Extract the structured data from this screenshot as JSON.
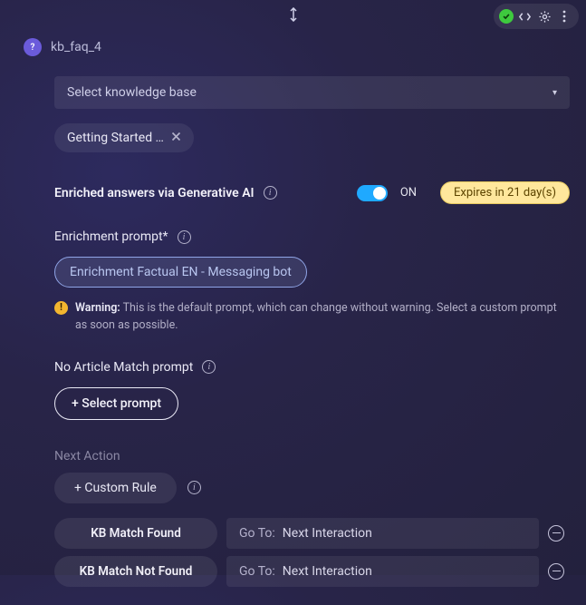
{
  "header": {
    "title": "kb_faq_4",
    "badge": "?"
  },
  "knowledge_base": {
    "placeholder": "Select knowledge base",
    "chip_label": "Getting Started …"
  },
  "enriched": {
    "label": "Enriched answers via Generative AI",
    "toggle_state": "ON",
    "expiry": "Expires in 21 day(s)"
  },
  "enrichment_prompt": {
    "label": "Enrichment prompt*",
    "selected": "Enrichment Factual EN - Messaging bot",
    "warning_label": "Warning:",
    "warning_text": "This is the default prompt, which can change without warning. Select a custom prompt as soon as possible."
  },
  "no_article": {
    "label": "No Article Match prompt",
    "button": "+ Select prompt"
  },
  "next_action": {
    "heading": "Next Action",
    "custom_rule_btn": "+ Custom Rule",
    "rules": [
      {
        "label": "KB Match Found",
        "goto_label": "Go To:",
        "goto_target": "Next Interaction"
      },
      {
        "label": "KB Match Not Found",
        "goto_label": "Go To:",
        "goto_target": "Next Interaction"
      }
    ]
  }
}
